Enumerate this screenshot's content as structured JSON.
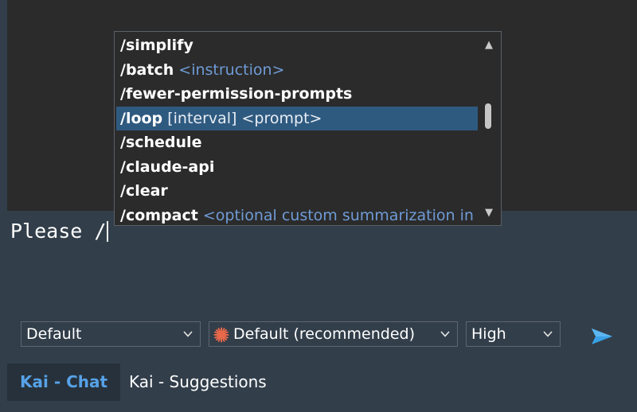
{
  "autocomplete": {
    "items": [
      {
        "name": "/simplify",
        "args": "",
        "selected": false
      },
      {
        "name": "/batch",
        "args": " <instruction>",
        "selected": false
      },
      {
        "name": "/fewer-permission-prompts",
        "args": "",
        "selected": false
      },
      {
        "name": "/loop",
        "args": " [interval] <prompt>",
        "selected": true
      },
      {
        "name": "/schedule",
        "args": "",
        "selected": false
      },
      {
        "name": "/claude-api",
        "args": "",
        "selected": false
      },
      {
        "name": "/clear",
        "args": "",
        "selected": false
      },
      {
        "name": "/compact",
        "args": " <optional custom summarization in",
        "selected": false
      }
    ]
  },
  "input": {
    "value": "Please /"
  },
  "controls": {
    "mode": "Default",
    "model": "Default (recommended)",
    "effort": "High"
  },
  "tabs": [
    {
      "label": "Kai - Chat",
      "active": true
    },
    {
      "label": "Kai - Suggestions",
      "active": false
    }
  ],
  "colors": {
    "accent": "#56a2e8",
    "selection": "#2f5a80",
    "arg_text": "#6f9bd6",
    "model_icon": "#e8684a"
  }
}
